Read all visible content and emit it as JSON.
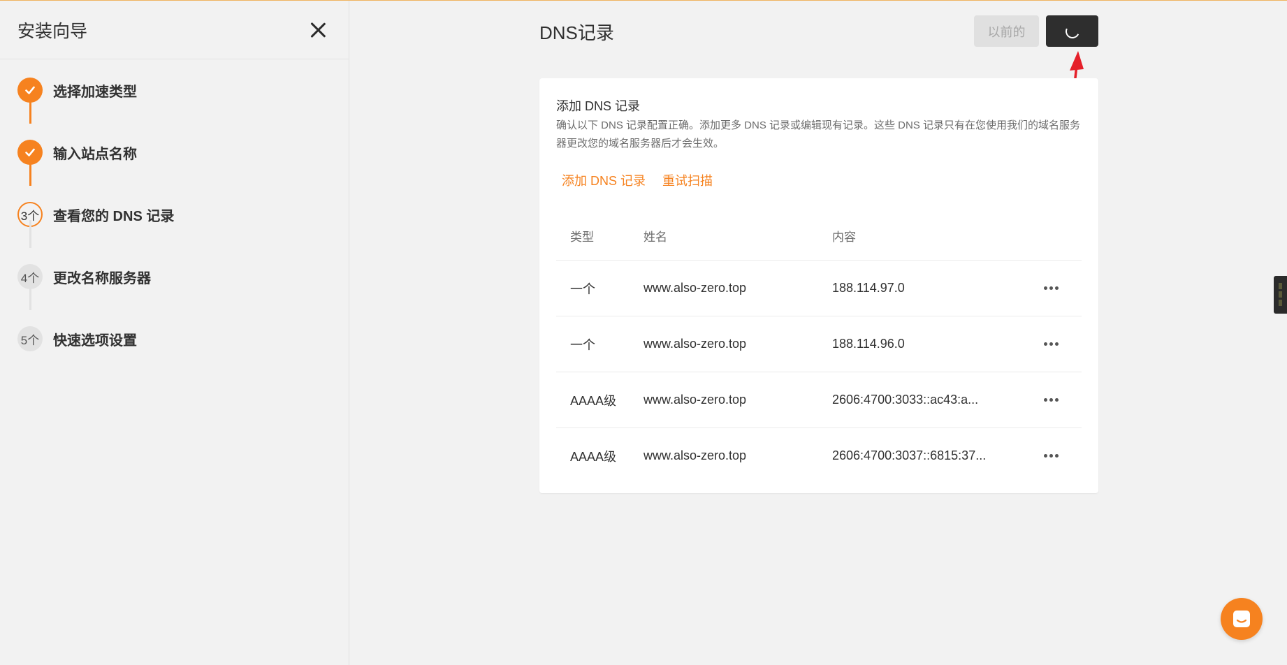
{
  "sidebar": {
    "title": "安装向导",
    "steps": [
      {
        "number": "1",
        "label": "选择加速类型",
        "status": "done"
      },
      {
        "number": "2",
        "label": "输入站点名称",
        "status": "done"
      },
      {
        "number": "3个",
        "label": "查看您的 DNS 记录",
        "status": "current"
      },
      {
        "number": "4个",
        "label": "更改名称服务器",
        "status": "pending"
      },
      {
        "number": "5个",
        "label": "快速选项设置",
        "status": "pending"
      }
    ]
  },
  "header": {
    "title": "DNS记录",
    "prev_label": "以前的"
  },
  "card": {
    "title": "添加 DNS 记录",
    "description": "确认以下 DNS 记录配置正确。添加更多 DNS 记录或编辑现有记录。这些 DNS 记录只有在您使用我们的域名服务器更改您的域名服务器后才会生效。",
    "add_link": "添加 DNS 记录",
    "rescan_link": "重试扫描"
  },
  "table": {
    "headers": {
      "type": "类型",
      "name": "姓名",
      "content": "内容"
    },
    "rows": [
      {
        "type": "一个",
        "name": "www.also-zero.top",
        "content": "188.114.97.0"
      },
      {
        "type": "一个",
        "name": "www.also-zero.top",
        "content": "188.114.96.0"
      },
      {
        "type": "AAAA级",
        "name": "www.also-zero.top",
        "content": "2606:4700:3033::ac43:a..."
      },
      {
        "type": "AAAA级",
        "name": "www.also-zero.top",
        "content": "2606:4700:3037::6815:37..."
      }
    ]
  },
  "colors": {
    "accent": "#f6821f",
    "dark_button": "#2e2e2e",
    "annotation_arrow": "#e5202a"
  },
  "icons": {
    "close": "close-icon",
    "check": "check-icon",
    "spinner": "loading-spinner-icon",
    "more": "more-horizontal-icon",
    "chat": "chat-icon"
  }
}
